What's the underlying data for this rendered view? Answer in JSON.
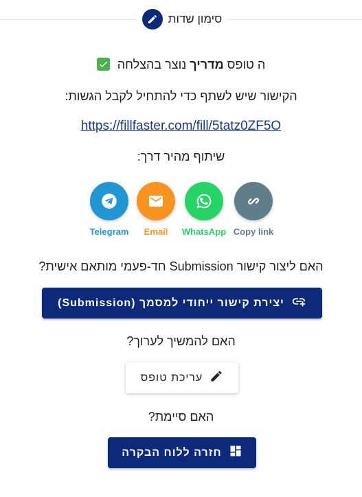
{
  "header": {
    "title": "סימון שדות"
  },
  "success": {
    "prefix": "ה טופס",
    "form_name": "מדריך",
    "suffix": "נוצר בהצלחה"
  },
  "share": {
    "instruction": "הקישור שיש לשתף כדי להתחיל לקבל הגשות:",
    "link": "https://fillfaster.com/fill/5tatz0ZF5O",
    "quick_label": "שיתוף מהיר דרך:",
    "options": [
      {
        "label": "Telegram",
        "color": "#2196d3",
        "icon": "telegram-icon"
      },
      {
        "label": "Email",
        "color": "#f7931e",
        "icon": "email-icon"
      },
      {
        "label": "WhatsApp",
        "color": "#25d366",
        "icon": "whatsapp-icon"
      },
      {
        "label": "Copy link",
        "color": "#607d8b",
        "icon": "link-icon"
      }
    ]
  },
  "submission": {
    "question": "האם ליצור קישור Submission חד-פעמי מותאם אישית?",
    "button_label": "יצירת קישור ייחודי למסמך (Submission)"
  },
  "edit": {
    "question": "האם להמשיך לערוך?",
    "button_label": "עריכת טופס"
  },
  "finish": {
    "question": "האם סיימת?",
    "button_label": "חזרה ללוח הבקרה"
  },
  "colors": {
    "primary": "#0d2a7a",
    "success": "#4caf50",
    "link": "#1a3a8a"
  }
}
